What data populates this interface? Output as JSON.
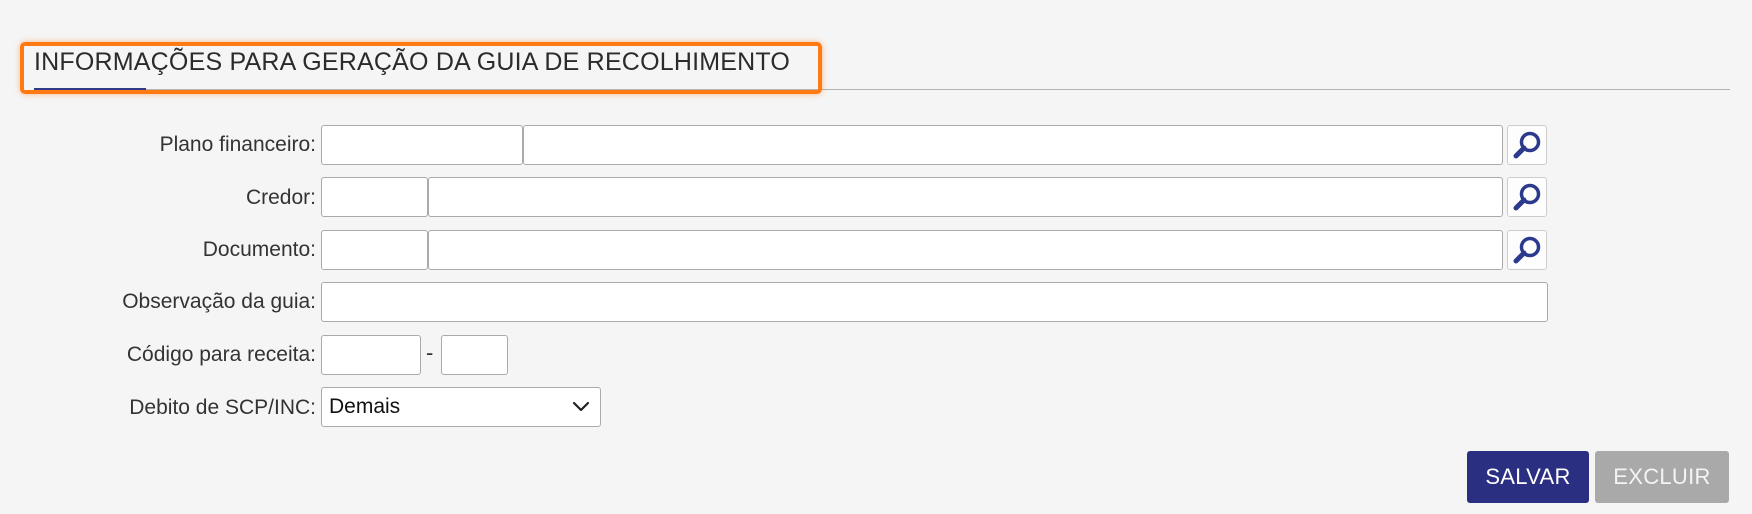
{
  "section": {
    "title": "INFORMAÇÕES PARA GERAÇÃO DA GUIA DE RECOLHIMENTO"
  },
  "form": {
    "plano_financeiro": {
      "label": "Plano financeiro:",
      "code": "",
      "description": ""
    },
    "credor": {
      "label": "Credor:",
      "code": "",
      "description": ""
    },
    "documento": {
      "label": "Documento:",
      "code": "",
      "description": ""
    },
    "observacao": {
      "label": "Observação da guia:",
      "value": ""
    },
    "codigo_receita": {
      "label": "Código para receita:",
      "part1": "",
      "separator": "-",
      "part2": ""
    },
    "debito": {
      "label": "Debito de SCP/INC:",
      "selected": "Demais"
    }
  },
  "buttons": {
    "save": "SALVAR",
    "delete": "EXCLUIR"
  },
  "colors": {
    "accent": "#2b2f82",
    "highlight": "#ff7a12",
    "disabled": "#a9a9a9"
  }
}
